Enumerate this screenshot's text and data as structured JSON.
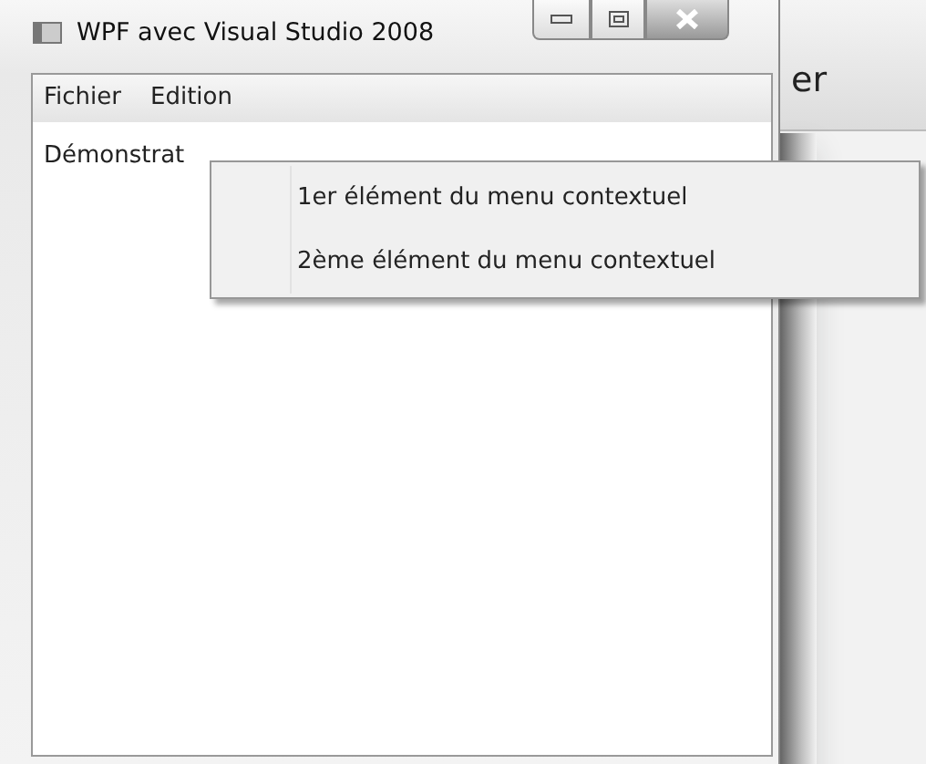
{
  "window": {
    "title": "WPF avec Visual Studio 2008"
  },
  "menu_bar": [
    {
      "label": "Fichier"
    },
    {
      "label": "Edition"
    }
  ],
  "content_text": "Démonstrat",
  "background_window": {
    "text": "er"
  },
  "context_menu": [
    {
      "label": "1er élément du menu contextuel"
    },
    {
      "label": "2ème élément du menu contextuel"
    }
  ]
}
